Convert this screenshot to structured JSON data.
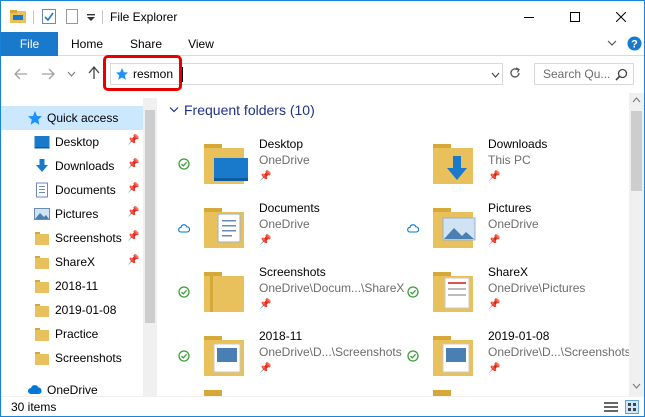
{
  "window": {
    "title": "File Explorer"
  },
  "colors": {
    "accent": "#1979ca",
    "selection": "#cce8ff",
    "folder": "#e8c15c",
    "highlight_box": "#e60000",
    "onedrive_blue": "#0078d7",
    "synced_green": "#3a9e3a"
  },
  "ribbon": {
    "tabs": [
      {
        "label": "File",
        "active": true
      },
      {
        "label": "Home"
      },
      {
        "label": "Share"
      },
      {
        "label": "View"
      }
    ]
  },
  "address_bar": {
    "value": "resmon",
    "icon": "quick-access-star-icon"
  },
  "search": {
    "placeholder": "Search Qu..."
  },
  "sidebar": {
    "items": [
      {
        "label": "Quick access",
        "icon": "star-icon",
        "selected": true,
        "pinned": false
      },
      {
        "label": "Desktop",
        "icon": "desktop-icon",
        "pinned": true
      },
      {
        "label": "Downloads",
        "icon": "download-arrow-icon",
        "pinned": true
      },
      {
        "label": "Documents",
        "icon": "documents-icon",
        "pinned": true
      },
      {
        "label": "Pictures",
        "icon": "pictures-icon",
        "pinned": true
      },
      {
        "label": "Screenshots",
        "icon": "folder-icon",
        "pinned": true
      },
      {
        "label": "ShareX",
        "icon": "folder-icon",
        "pinned": true
      },
      {
        "label": "2018-11",
        "icon": "folder-icon",
        "pinned": false
      },
      {
        "label": "2019-01-08",
        "icon": "folder-icon",
        "pinned": false
      },
      {
        "label": "Practice",
        "icon": "folder-icon",
        "pinned": false
      },
      {
        "label": "Screenshots",
        "icon": "folder-icon",
        "pinned": false
      },
      {
        "label": "OneDrive",
        "icon": "cloud-icon",
        "pinned": false
      }
    ]
  },
  "main": {
    "group_title": "Frequent folders (10)",
    "folders": [
      {
        "name": "Desktop",
        "location": "OneDrive",
        "status": "synced-check-icon",
        "icon": "desktop-folder-icon"
      },
      {
        "name": "Downloads",
        "location": "This PC",
        "status": "",
        "icon": "downloads-folder-icon"
      },
      {
        "name": "Documents",
        "location": "OneDrive",
        "status": "cloud-icon",
        "icon": "documents-folder-icon"
      },
      {
        "name": "Pictures",
        "location": "OneDrive",
        "status": "cloud-icon",
        "icon": "pictures-folder-icon"
      },
      {
        "name": "Screenshots",
        "location": "OneDrive\\Docum...\\ShareX",
        "status": "synced-check-icon",
        "icon": "folder-icon"
      },
      {
        "name": "ShareX",
        "location": "OneDrive\\Pictures",
        "status": "synced-check-icon",
        "icon": "folder-icon"
      },
      {
        "name": "2018-11",
        "location": "OneDrive\\D...\\Screenshots",
        "status": "synced-check-icon",
        "icon": "folder-icon"
      },
      {
        "name": "2019-01-08",
        "location": "OneDrive\\D...\\Screenshots",
        "status": "synced-check-icon",
        "icon": "folder-icon"
      }
    ]
  },
  "statusbar": {
    "item_count": "30 items"
  }
}
